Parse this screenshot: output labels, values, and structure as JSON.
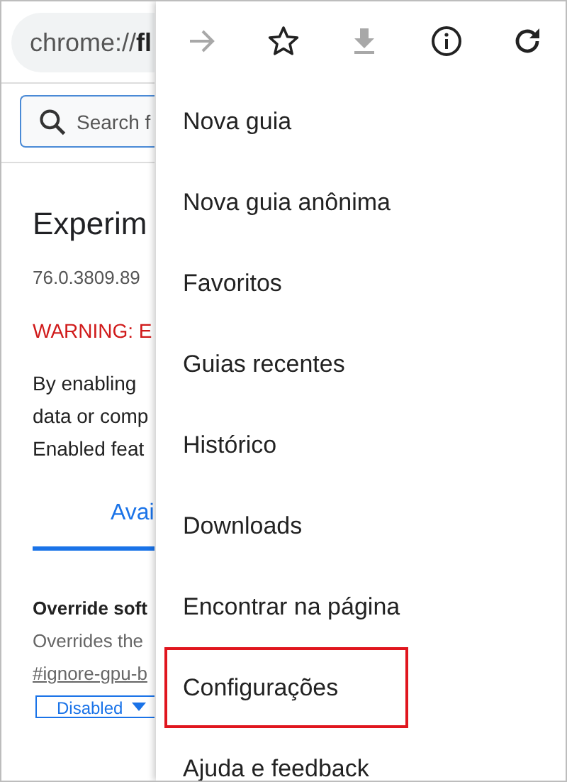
{
  "address_bar": {
    "url": "chrome://**fl**"
  },
  "search": {
    "placeholder": "Search f"
  },
  "page": {
    "title": "Experim",
    "version": "76.0.3809.89",
    "warning": "WARNING: E",
    "intro_lines": [
      "By enabling",
      "data or comp",
      "Enabled feat"
    ],
    "tabs": [
      {
        "label": "Avai",
        "selected": true
      }
    ],
    "flag": {
      "name": "Override soft",
      "description": "Overrides the",
      "link": "#ignore-gpu-b",
      "dropdown": "Disabled"
    }
  },
  "menu": {
    "toolbar": [
      {
        "kind": "forward",
        "disabled": true
      },
      {
        "kind": "star",
        "disabled": false
      },
      {
        "kind": "download",
        "disabled": true
      },
      {
        "kind": "info",
        "disabled": false
      },
      {
        "kind": "reload",
        "disabled": false
      }
    ],
    "items": [
      {
        "label": "Nova guia",
        "highlighted": false
      },
      {
        "label": "Nova guia anônima",
        "highlighted": false
      },
      {
        "label": "Favoritos",
        "highlighted": false
      },
      {
        "label": "Guias recentes",
        "highlighted": false
      },
      {
        "label": "Histórico",
        "highlighted": false
      },
      {
        "label": "Downloads",
        "highlighted": false
      },
      {
        "label": "Encontrar na página",
        "highlighted": false
      },
      {
        "label": "Configurações",
        "highlighted": true
      },
      {
        "label": "Ajuda e feedback",
        "highlighted": false
      }
    ]
  }
}
